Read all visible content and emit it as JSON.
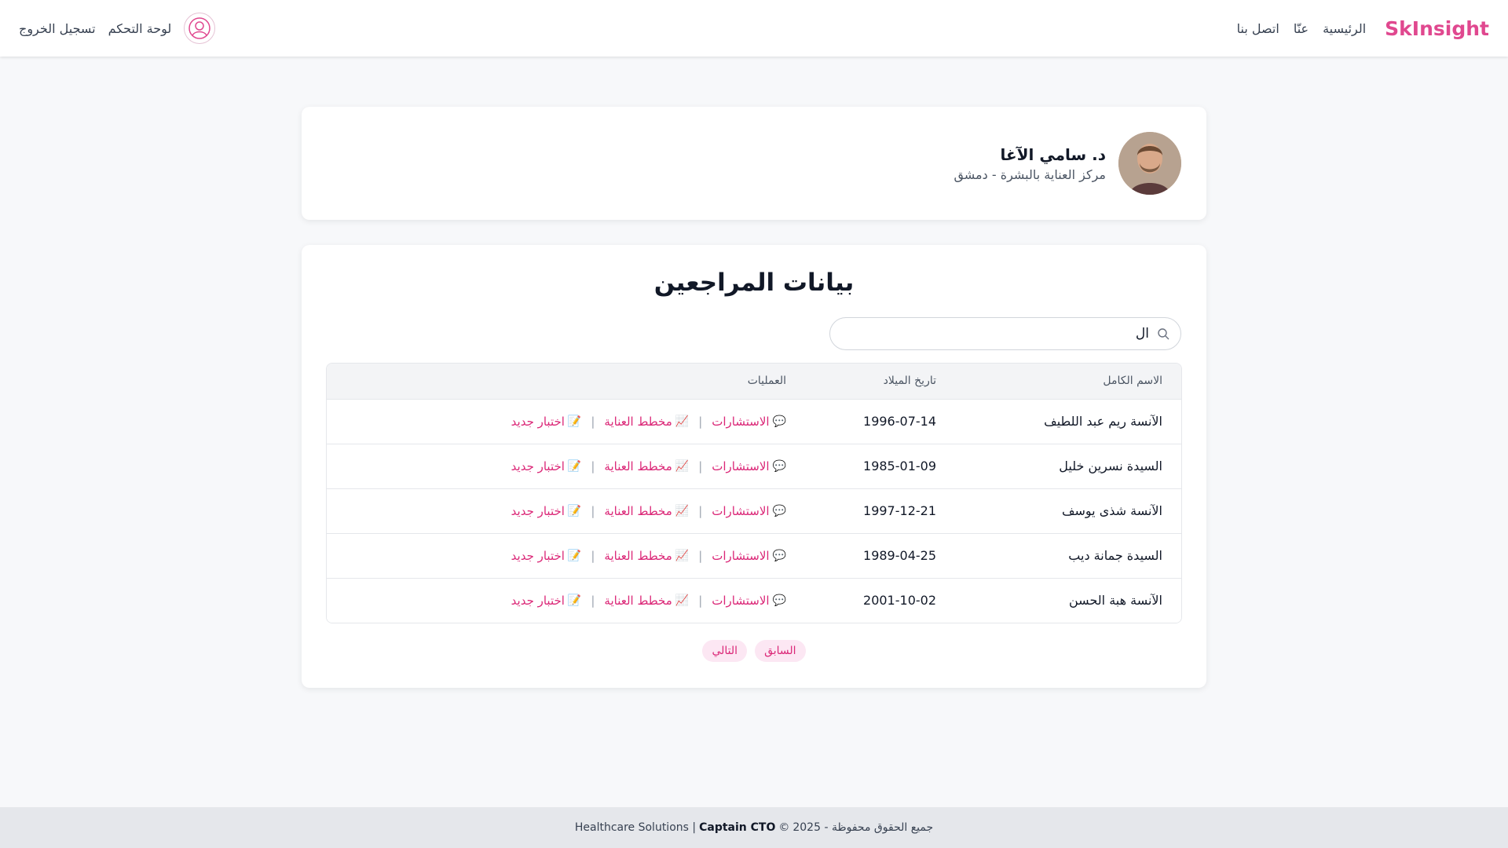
{
  "nav": {
    "brand": "SkInsight",
    "home": "الرئيسية",
    "about": "عنّا",
    "contact": "اتصل بنا",
    "dashboard": "لوحة التحكم",
    "logout": "تسجيل الخروج"
  },
  "profile": {
    "name": "د. سامي الآغا",
    "place": "مركز العناية بالبشرة - دمشق"
  },
  "patients": {
    "title": "بيانات المراجعين",
    "search_value": "ال",
    "headers": {
      "name": "الاسم الكامل",
      "dob": "تاريخ الميلاد",
      "ops": "العمليات"
    },
    "ops_labels": {
      "consult": "الاستشارات",
      "plan": "مخطط العناية",
      "test": "اختبار جديد",
      "consult_icon": "💬",
      "plan_icon": "📈",
      "test_icon": "📝"
    },
    "rows": [
      {
        "name": "الآنسة ريم عبد اللطيف",
        "dob": "1996-07-14"
      },
      {
        "name": "السيدة نسرين خليل",
        "dob": "1985-01-09"
      },
      {
        "name": "الآنسة شذى يوسف",
        "dob": "1997-12-21"
      },
      {
        "name": "السيدة جمانة ديب",
        "dob": "1989-04-25"
      },
      {
        "name": "الآنسة هبة الحسن",
        "dob": "2001-10-02"
      }
    ],
    "prev": "السابق",
    "next": "التالي"
  },
  "footer": {
    "rights": "جميع الحقوق محفوظة - 2025",
    "copyright_symbol": "©",
    "company_bold": "Captain CTO",
    "company_rest": "| Healthcare Solutions"
  },
  "colors": {
    "brand": "#e0488f",
    "link": "#db2777",
    "pager_bg": "#fce7f3"
  }
}
